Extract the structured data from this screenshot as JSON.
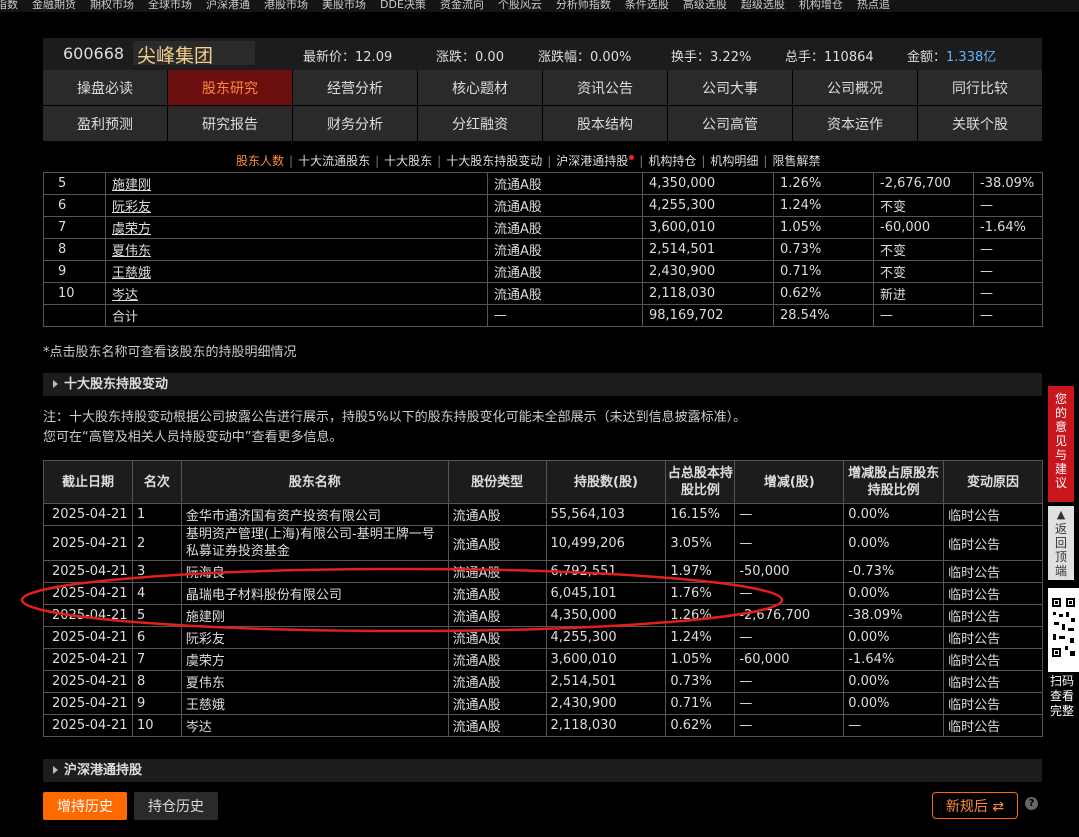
{
  "topnav": [
    "指数",
    "金融期货",
    "期权市场",
    "全球市场",
    "沪深港通",
    "港股市场",
    "美股市场",
    "DDE决策",
    "资金流向",
    "个股风云",
    "分析师指数",
    "条件选股",
    "高级选股",
    "超级选股",
    "机构增仓",
    "热点追"
  ],
  "stock": {
    "code": "600668",
    "name": "尖峰集团",
    "price_label": "最新价：",
    "price": "12.09",
    "change_label": "涨跌：",
    "change": "0.00",
    "change_pct_label": "涨跌幅：",
    "change_pct": "0.00%",
    "turnover_label": "换手：",
    "turnover": "3.22%",
    "volume_label": "总手：",
    "volume": "110864",
    "amount_label": "金额：",
    "amount": "1.338亿"
  },
  "tabs_row1": [
    "操盘必读",
    "股东研究",
    "经营分析",
    "核心题材",
    "资讯公告",
    "公司大事",
    "公司概况",
    "同行比较"
  ],
  "tabs_row2": [
    "盈利预测",
    "研究报告",
    "财务分析",
    "分红融资",
    "股本结构",
    "公司高管",
    "资本运作",
    "关联个股"
  ],
  "subnav": [
    "股东人数",
    "十大流通股东",
    "十大股东",
    "十大股东持股变动",
    "沪深港通持股",
    "机构持仓",
    "机构明细",
    "限售解禁"
  ],
  "top_table": [
    [
      "5",
      "施建刚",
      "流通A股",
      "4,350,000",
      "1.26%",
      "-2,676,700",
      "-38.09%"
    ],
    [
      "6",
      "阮彩友",
      "流通A股",
      "4,255,300",
      "1.24%",
      "不变",
      "—"
    ],
    [
      "7",
      "虞荣方",
      "流通A股",
      "3,600,010",
      "1.05%",
      "-60,000",
      "-1.64%"
    ],
    [
      "8",
      "夏伟东",
      "流通A股",
      "2,514,501",
      "0.73%",
      "不变",
      "—"
    ],
    [
      "9",
      "王慈娥",
      "流通A股",
      "2,430,900",
      "0.71%",
      "不变",
      "—"
    ],
    [
      "10",
      "岑达",
      "流通A股",
      "2,118,030",
      "0.62%",
      "新进",
      "—"
    ]
  ],
  "top_total": [
    "",
    "合计",
    "—",
    "98,169,702",
    "28.54%",
    "—",
    "—"
  ],
  "note1": "*点击股东名称可查看该股东的持股明细情况",
  "section2_title": "十大股东持股变动",
  "notes2": [
    "注：十大股东持股变动根据公司披露公告进行展示，持股5%以下的股东持股变化可能未全部展示（未达到信息披露标准）。",
    "您可在“高管及相关人员持股变动中”查看更多信息。"
  ],
  "change_headers": [
    "截止日期",
    "名次",
    "股东名称",
    "股份类型",
    "持股数(股)",
    "占总股本持股比例",
    "增减(股)",
    "增减股占原股东持股比例",
    "变动原因"
  ],
  "change_rows": [
    [
      "2025-04-21",
      "1",
      "金华市通济国有资产投资有限公司",
      "流通A股",
      "55,564,103",
      "16.15%",
      "—",
      "0.00%",
      "临时公告"
    ],
    [
      "2025-04-21",
      "2",
      "基明资产管理(上海)有限公司-基明王牌一号私募证券投资基金",
      "流通A股",
      "10,499,206",
      "3.05%",
      "—",
      "0.00%",
      "临时公告"
    ],
    [
      "2025-04-21",
      "3",
      "阮海良",
      "流通A股",
      "6,792,551",
      "1.97%",
      "-50,000",
      "-0.73%",
      "临时公告"
    ],
    [
      "2025-04-21",
      "4",
      "晶瑞电子材料股份有限公司",
      "流通A股",
      "6,045,101",
      "1.76%",
      "—",
      "0.00%",
      "临时公告"
    ],
    [
      "2025-04-21",
      "5",
      "施建刚",
      "流通A股",
      "4,350,000",
      "1.26%",
      "-2,676,700",
      "-38.09%",
      "临时公告"
    ],
    [
      "2025-04-21",
      "6",
      "阮彩友",
      "流通A股",
      "4,255,300",
      "1.24%",
      "—",
      "0.00%",
      "临时公告"
    ],
    [
      "2025-04-21",
      "7",
      "虞荣方",
      "流通A股",
      "3,600,010",
      "1.05%",
      "-60,000",
      "-1.64%",
      "临时公告"
    ],
    [
      "2025-04-21",
      "8",
      "夏伟东",
      "流通A股",
      "2,514,501",
      "0.73%",
      "—",
      "0.00%",
      "临时公告"
    ],
    [
      "2025-04-21",
      "9",
      "王慈娥",
      "流通A股",
      "2,430,900",
      "0.71%",
      "—",
      "0.00%",
      "临时公告"
    ],
    [
      "2025-04-21",
      "10",
      "岑达",
      "流通A股",
      "2,118,030",
      "0.62%",
      "—",
      "—",
      "临时公告"
    ]
  ],
  "section3_title": "沪深港通持股",
  "buttons": {
    "increase": "增持历史",
    "holdings": "持仓历史",
    "new_rule": "新规后 ⇄",
    "help": "?"
  },
  "side": {
    "feedback": "您的意见与建议",
    "back_top": "返回顶端",
    "scan": "扫码查看完整"
  },
  "colors": {
    "accent": "#ff6a00",
    "up": "#ff4a3a",
    "down": "#3ee06c",
    "annotation": "#e0201a"
  }
}
